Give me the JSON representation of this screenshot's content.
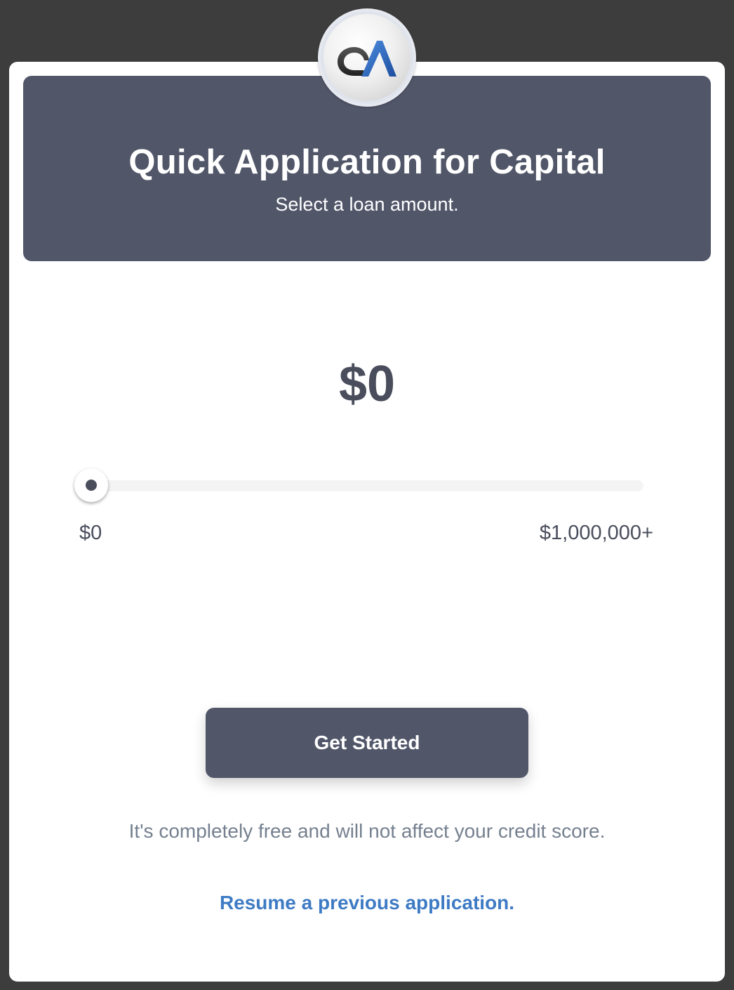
{
  "header": {
    "title": "Quick Application for Capital",
    "subtitle": "Select a loan amount."
  },
  "logo": {
    "icon": "qa-logo-icon",
    "text": "QA"
  },
  "loan": {
    "amount_display": "$0",
    "slider_value_fraction": 0,
    "min_label": "$0",
    "max_label": "$1,000,000+"
  },
  "cta": {
    "label": "Get Started"
  },
  "note": "It's completely free and will not affect your credit score.",
  "resume_link": "Resume a previous application.",
  "colors": {
    "header_bg": "#515669",
    "button_bg": "#515669",
    "link": "#3e7bc4",
    "background": "#3d3d3d"
  }
}
